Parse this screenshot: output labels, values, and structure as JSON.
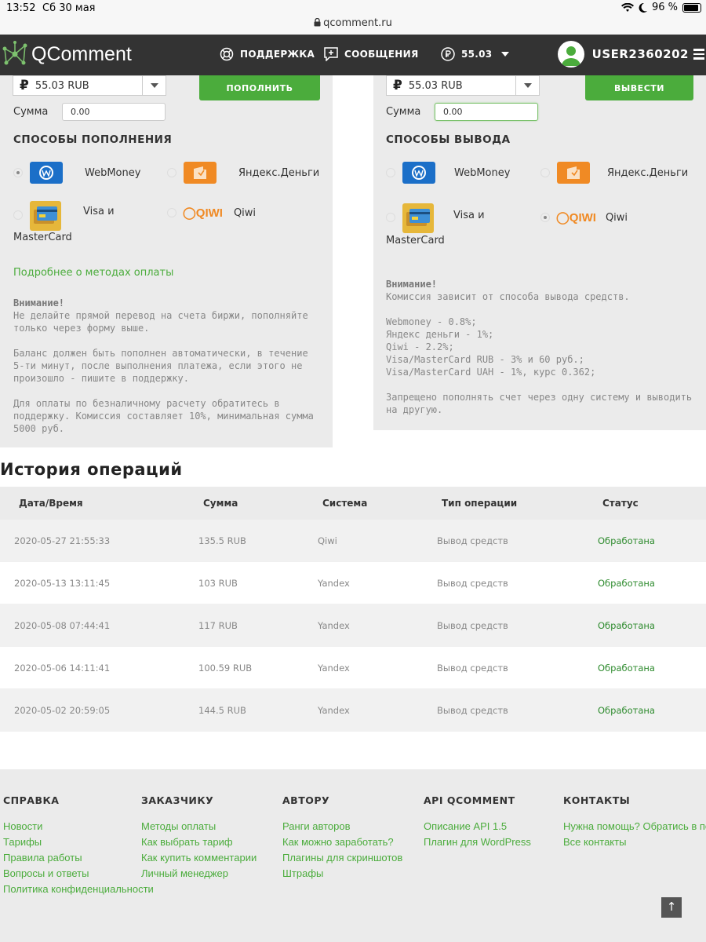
{
  "statusbar": {
    "time": "13:52",
    "date": "Сб 30 мая",
    "battery": "96 %"
  },
  "browser": {
    "url": "qcomment.ru"
  },
  "nav": {
    "logo": "QComment",
    "support": "ПОДДЕРЖКА",
    "messages": "СООБЩЕНИЯ",
    "balance": "55.03",
    "username": "USER2360202"
  },
  "deposit": {
    "currency_value": "55.03 RUB",
    "button": "ПОПОЛНИТЬ",
    "sum_label": "Сумма",
    "sum_value": "0.00",
    "methods_title": "СПОСОБЫ ПОПОЛНЕНИЯ",
    "methods": {
      "webmoney": "WebMoney",
      "yandex": "Яндекс.Деньги",
      "visa_line1": "Visa и",
      "visa_line2": "MasterCard",
      "qiwi": "Qiwi"
    },
    "more_link": "Подробнее о методах оплаты",
    "attention": "Внимание!",
    "note1": "Не делайте прямой перевод на счета биржи, пополняйте только через форму выше.",
    "note2": "Баланс должен быть пополнен автоматически, в течение 5-ти минут, после выполнения платежа, если этого не произошло - пишите в поддержку.",
    "note3": "Для оплаты по безналичному расчету обратитесь в поддержку. Комиссия составляет 10%, минимальная сумма 5000 руб."
  },
  "withdraw": {
    "currency_value": "55.03 RUB",
    "button": "ВЫВЕСТИ",
    "sum_label": "Сумма",
    "sum_value": "0.00",
    "methods_title": "СПОСОБЫ ВЫВОДА",
    "methods": {
      "webmoney": "WebMoney",
      "yandex": "Яндекс.Деньги",
      "visa_line1": "Visa и",
      "visa_line2": "MasterCard",
      "qiwi": "Qiwi"
    },
    "attention": "Внимание!",
    "commission": "Комиссия зависит от способа вывода средств.",
    "rates": [
      "Webmoney - 0.8%;",
      "Яндекс деньги - 1%;",
      "Qiwi - 2.2%;",
      "Visa/MasterCard RUB - 3% и 60 руб.;",
      "Visa/MasterCard UAH - 1%, курс 0.362;"
    ],
    "forbidden": "Запрещено пополнять счет через одну систему и выводить на другую."
  },
  "history": {
    "title": "История операций",
    "columns": [
      "Дата/Время",
      "Сумма",
      "Система",
      "Тип операции",
      "Статус"
    ],
    "rows": [
      [
        "2020-05-27 21:55:33",
        "135.5 RUB",
        "Qiwi",
        "Вывод средств",
        "Обработана"
      ],
      [
        "2020-05-13 13:11:45",
        "103 RUB",
        "Yandex",
        "Вывод средств",
        "Обработана"
      ],
      [
        "2020-05-08 07:44:41",
        "117 RUB",
        "Yandex",
        "Вывод средств",
        "Обработана"
      ],
      [
        "2020-05-06 14:11:41",
        "100.59 RUB",
        "Yandex",
        "Вывод средств",
        "Обработана"
      ],
      [
        "2020-05-02 20:59:05",
        "144.5 RUB",
        "Yandex",
        "Вывод средств",
        "Обработана"
      ]
    ]
  },
  "footer": {
    "columns": [
      {
        "title": "СПРАВКА",
        "links": [
          "Новости",
          "Тарифы",
          "Правила работы",
          "Вопросы и ответы",
          "Политика конфиденциальности"
        ]
      },
      {
        "title": "ЗАКАЗЧИКУ",
        "links": [
          "Методы оплаты",
          "Как выбрать тариф",
          "Как купить комментарии",
          "Личный менеджер"
        ]
      },
      {
        "title": "АВТОРУ",
        "links": [
          "Ранги авторов",
          "Как можно заработать?",
          "Плагины для скриншотов",
          "Штрафы"
        ]
      },
      {
        "title": "API QCOMMENT",
        "links": [
          "Описание API 1.5",
          "Плагин для WordPress"
        ]
      },
      {
        "title": "КОНТАКТЫ",
        "links": [
          "Нужна помощь? Обратись в под",
          "Все контакты"
        ]
      }
    ],
    "to_top": "↑"
  },
  "colors": {
    "accent": "#4bac3c",
    "nav_bg": "#333333",
    "panel_bg": "#ebebeb",
    "status_ok": "#2e8b2e"
  }
}
